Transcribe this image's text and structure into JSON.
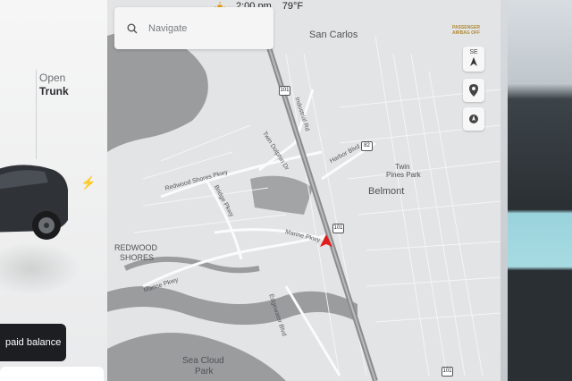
{
  "status": {
    "time": "2:00 pm",
    "temperature": "79°F"
  },
  "left_panel": {
    "trunk_line1": "Open",
    "trunk_line2": "Trunk",
    "balance_label": "paid balance"
  },
  "search": {
    "placeholder": "Navigate"
  },
  "compass": {
    "heading": "SE",
    "icon": "north-arrow-icon"
  },
  "partner_badge": {
    "line1": "PASSENGER",
    "line2": "AIRBAG OFF"
  },
  "map": {
    "places": [
      {
        "name": "San Carlos"
      },
      {
        "name": "Belmont"
      },
      {
        "name": "Twin"
      },
      {
        "name": "Pines Park"
      },
      {
        "name": "REDWOOD"
      },
      {
        "name": "SHORES"
      },
      {
        "name": "Sea Cloud"
      },
      {
        "name": "Park"
      }
    ],
    "roads": [
      {
        "name": "Industrial Rd"
      },
      {
        "name": "Twin Dolphin Dr"
      },
      {
        "name": "Redwood Shores Pkwy"
      },
      {
        "name": "Bridge Pkwy"
      },
      {
        "name": "Harbor Blvd"
      },
      {
        "name": "Marine Pkwy"
      },
      {
        "name": "Marine Pkwy"
      },
      {
        "name": "Edgewater Blvd"
      }
    ],
    "shields": [
      "101",
      "101",
      "82",
      "101"
    ],
    "colors": {
      "land": "#e3e4e5",
      "water": "#9a9c9e",
      "highway": "#8a8c8e",
      "marker": "#e31b1b"
    }
  }
}
